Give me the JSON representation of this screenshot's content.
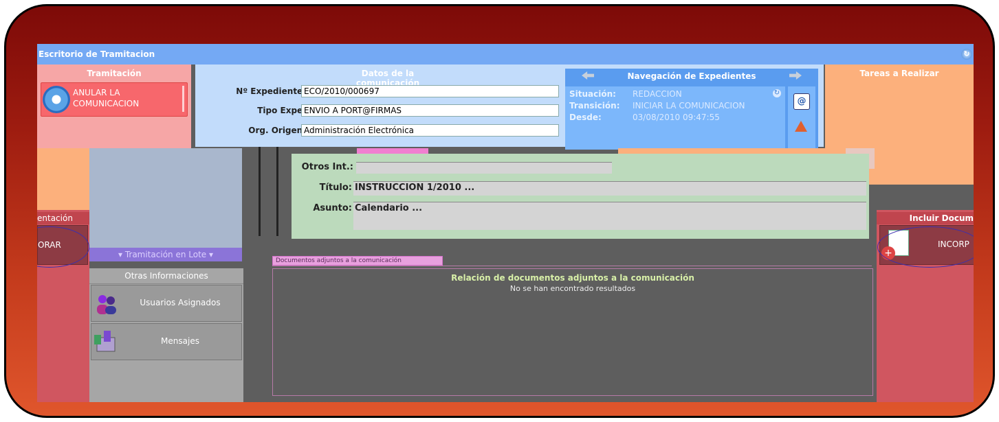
{
  "titlebar": {
    "title": "Escritorio de Tramitacion"
  },
  "tramitacion": {
    "header": "Tramitación",
    "anular_label": "ANULAR LA COMUNICACION"
  },
  "datos": {
    "header": "Datos de la comunicación",
    "fields": [
      {
        "label": "Nº Expediente:",
        "value": "ECO/2010/000697"
      },
      {
        "label": "Tipo Expe:",
        "value": "ENVIO A PORT@FIRMAS"
      },
      {
        "label": "Org. Origen:",
        "value": "Administración Electrónica"
      }
    ]
  },
  "navegacion": {
    "header": "Navegación de Expedientes",
    "situacion_label": "Situación:",
    "situacion_value": "REDACCION",
    "transicion_label": "Transición:",
    "transicion_value": "INICIAR LA COMUNICACION",
    "desde_label": "Desde:",
    "desde_value": "03/08/2010 09:47:55"
  },
  "tareas": {
    "header": "Tareas a Realizar"
  },
  "form": {
    "otros_label": "Otros Int.:",
    "titulo_label": "Título:",
    "titulo_value": "INSTRUCCION 1/2010 ...",
    "asunto_label": "Asunto:",
    "asunto_value": "Calendario ..."
  },
  "left_panel": {
    "header": "entación",
    "button": "ORAR"
  },
  "right_panel": {
    "header": "Incluir Docum",
    "button": "INCORP"
  },
  "lote": {
    "label": "▾ Tramitación en Lote ▾"
  },
  "otras": {
    "header": "Otras Informaciones",
    "usuarios": "Usuarios Asignados",
    "mensajes": "Mensajes"
  },
  "documentos": {
    "tab": "Documentos adjuntos a la comunicación",
    "title": "Relación de documentos adjuntos a la comunicación",
    "empty": "No se han encontrado resultados"
  }
}
